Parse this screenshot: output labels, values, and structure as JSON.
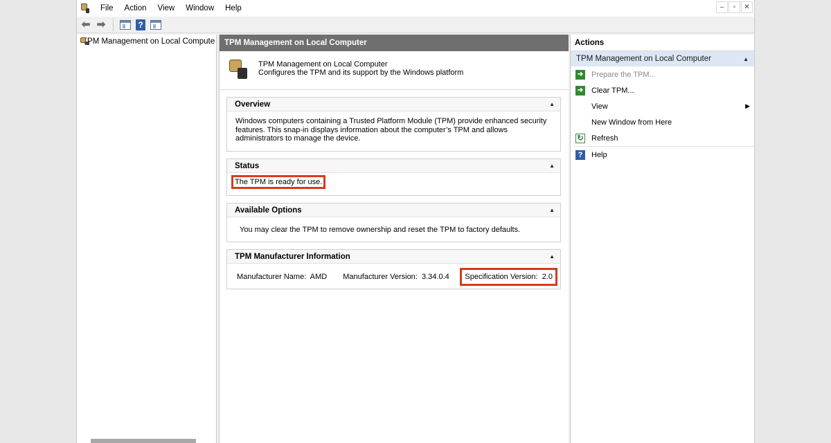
{
  "menu": {
    "items": [
      "File",
      "Action",
      "View",
      "Window",
      "Help"
    ]
  },
  "window_controls": {
    "minimize": "–",
    "restore": "▫",
    "close": "✕"
  },
  "tree": {
    "root_label": "TPM Management on Local Computer"
  },
  "center": {
    "header_title": "TPM Management on Local Computer",
    "intro_title": "TPM Management on Local Computer",
    "intro_desc": "Configures the TPM and its support by the Windows platform",
    "overview": {
      "title": "Overview",
      "text": "Windows computers containing a Trusted Platform Module (TPM) provide enhanced security features. This snap-in displays information about the computer’s TPM and allows administrators to manage the device."
    },
    "status": {
      "title": "Status",
      "text": "The TPM is ready for use."
    },
    "options": {
      "title": "Available Options",
      "text": "You may clear the TPM to remove ownership and reset the TPM to factory defaults."
    },
    "manufacturer": {
      "title": "TPM Manufacturer Information",
      "name_label": "Manufacturer Name:",
      "name_value": "AMD",
      "version_label": "Manufacturer Version:",
      "version_value": "3.34.0.4",
      "spec_label": "Specification Version:",
      "spec_value": "2.0"
    }
  },
  "actions": {
    "title": "Actions",
    "section_label": "TPM Management on Local Computer",
    "items": [
      {
        "label": "Prepare the TPM...",
        "icon": "green-arrow-icon",
        "disabled": true
      },
      {
        "label": "Clear TPM...",
        "icon": "green-arrow-icon",
        "disabled": false
      },
      {
        "label": "View",
        "icon": "",
        "disabled": false,
        "submenu": true
      },
      {
        "label": "New Window from Here",
        "icon": "",
        "disabled": false
      },
      {
        "label": "Refresh",
        "icon": "refresh-icon",
        "disabled": false
      },
      {
        "label": "Help",
        "icon": "help-icon",
        "disabled": false
      }
    ]
  },
  "colors": {
    "highlight_border": "#d93a1e",
    "header_bg": "#6f6f6f",
    "actions_section_bg": "#dce6f4"
  }
}
